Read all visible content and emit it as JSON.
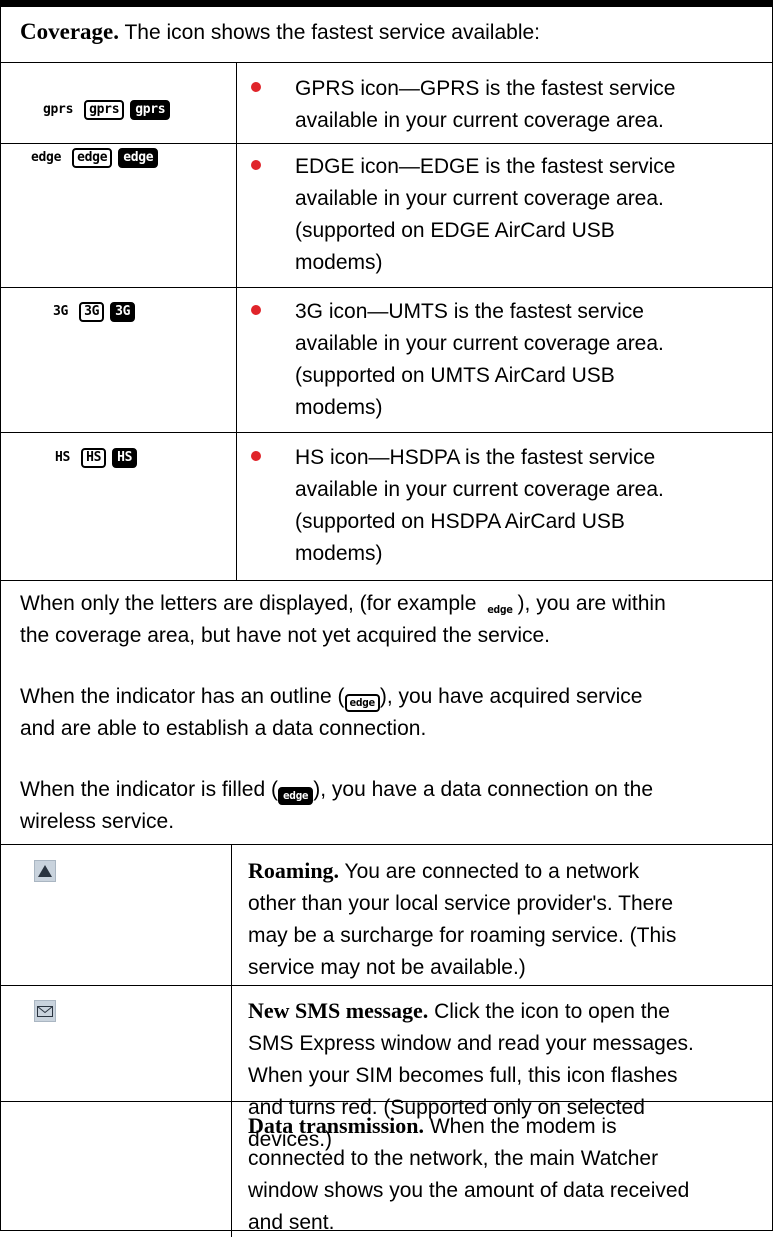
{
  "coverage": {
    "title": "Coverage.",
    "intro": " The icon shows the fastest service available:",
    "rows": [
      {
        "icon_text": [
          "gprs",
          "gprs",
          "gprs"
        ],
        "lines": [
          "GPRS icon—GPRS is the fastest service",
          "available in your current coverage area."
        ]
      },
      {
        "icon_text": [
          "edge",
          "edge",
          "edge"
        ],
        "lines": [
          "EDGE icon—EDGE is the fastest service",
          "available in your current coverage area.",
          "(supported on EDGE AirCard USB",
          "modems)"
        ]
      },
      {
        "icon_text": [
          "3G",
          "3G",
          "3G"
        ],
        "lines": [
          "3G icon—UMTS is the fastest service",
          "available in your current coverage area.",
          "(supported on UMTS AirCard USB",
          "modems)"
        ]
      },
      {
        "icon_text": [
          "HS",
          "HS",
          "HS"
        ],
        "lines": [
          "HS icon—HSDPA is the fastest service",
          "available in your current coverage area.",
          "(supported on HSDPA AirCard USB",
          "modems)"
        ]
      }
    ],
    "bullet_color": "#e0242a"
  },
  "notes": {
    "n1_a": "When only the letters are displayed, (for example ",
    "n1_icon": "edge",
    "n1_b": "), you are within",
    "n1_c": "the coverage area, but have not yet acquired the service.",
    "n2_a": "When the indicator has an outline (",
    "n2_icon": "edge",
    "n2_b": "), you have acquired service",
    "n2_c": "and are able to establish a data connection.",
    "n3_a": "When the indicator is filled (",
    "n3_icon": "edge",
    "n3_b": "), you have a data connection on the",
    "n3_c": "wireless service."
  },
  "features": [
    {
      "icon": "roaming-triangle-icon",
      "title": "Roaming.",
      "lines": [
        " You are connected to a network",
        "other than your local service provider's. There",
        "may be a surcharge for roaming service. (This",
        "service may not be available.)"
      ]
    },
    {
      "icon": "envelope-icon",
      "title": "New SMS message.",
      "lines": [
        " Click the icon to open the",
        "SMS Express window and read your messages.",
        "When your SIM becomes full, this icon flashes",
        "and turns red. (Supported only on selected",
        "devices.)"
      ]
    },
    {
      "icon": "",
      "title": "Data transmission.",
      "lines": [
        " When the modem is",
        "connected to the network, the main Watcher",
        "window shows you the amount of data received",
        "and sent."
      ]
    }
  ]
}
